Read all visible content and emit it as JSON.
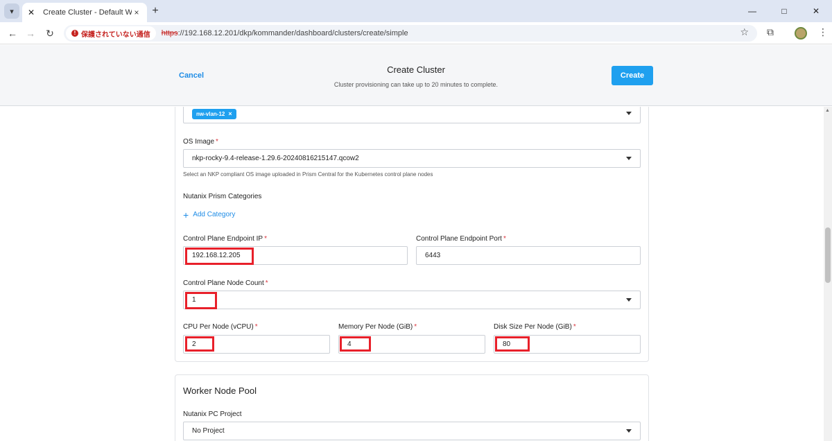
{
  "browser": {
    "tab_title": "Create Cluster - Default Workspace",
    "security_label": "保護されていない通信",
    "url_scheme": "https",
    "url_rest": "://192.168.12.201/dkp/kommander/dashboard/clusters/create/simple"
  },
  "header": {
    "cancel_label": "Cancel",
    "title": "Create Cluster",
    "subtitle": "Cluster provisioning can take up to 20 minutes to complete.",
    "create_label": "Create"
  },
  "form": {
    "subnet_chip": "nw-vlan-12",
    "os_image": {
      "label": "OS Image",
      "value": "nkp-rocky-9.4-release-1.29.6-20240816215147.qcow2",
      "helper": "Select an NKP compliant OS image uploaded in Prism Central for the Kubernetes control plane nodes"
    },
    "categories": {
      "label": "Nutanix Prism Categories",
      "add_label": "Add Category"
    },
    "endpoint_ip": {
      "label": "Control Plane Endpoint IP",
      "value": "192.168.12.205"
    },
    "endpoint_port": {
      "label": "Control Plane Endpoint Port",
      "value": "6443"
    },
    "node_count": {
      "label": "Control Plane Node Count",
      "value": "1"
    },
    "cpu": {
      "label": "CPU Per Node (vCPU)",
      "value": "2"
    },
    "memory": {
      "label": "Memory Per Node (GiB)",
      "value": "4"
    },
    "disk": {
      "label": "Disk Size Per Node (GiB)",
      "value": "80"
    }
  },
  "worker_pool": {
    "title": "Worker Node Pool",
    "project_label": "Nutanix PC Project",
    "project_value": "No Project"
  },
  "required_marker": "*",
  "colors": {
    "accent": "#1fa0ef",
    "highlight": "#e8202a",
    "required": "#d9363e"
  }
}
